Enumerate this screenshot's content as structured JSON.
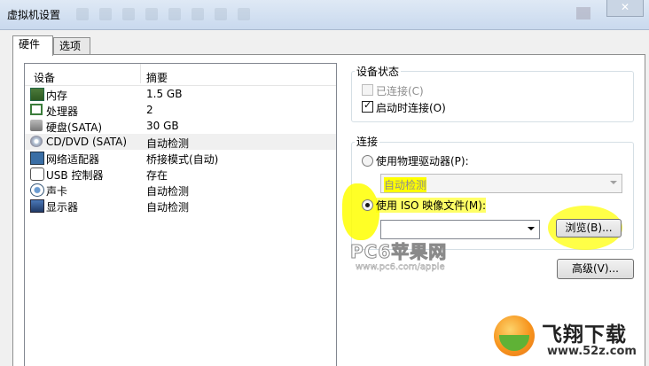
{
  "window": {
    "title": "虚拟机设置"
  },
  "tabs": [
    {
      "label": "硬件"
    },
    {
      "label": "选项"
    }
  ],
  "device_list": {
    "columns": [
      "设备",
      "摘要"
    ],
    "rows": [
      {
        "device": "内存",
        "summary": "1.5 GB",
        "icon": "memory-icon"
      },
      {
        "device": "处理器",
        "summary": "2",
        "icon": "processor-icon"
      },
      {
        "device": "硬盘(SATA)",
        "summary": "30 GB",
        "icon": "harddisk-icon"
      },
      {
        "device": "CD/DVD (SATA)",
        "summary": "自动检测",
        "icon": "cd-dvd-icon",
        "selected": true
      },
      {
        "device": "网络适配器",
        "summary": "桥接模式(自动)",
        "icon": "network-adapter-icon"
      },
      {
        "device": "USB 控制器",
        "summary": "存在",
        "icon": "usb-icon"
      },
      {
        "device": "声卡",
        "summary": "自动检测",
        "icon": "sound-card-icon"
      },
      {
        "device": "显示器",
        "summary": "自动检测",
        "icon": "display-icon"
      }
    ]
  },
  "device_status": {
    "legend": "设备状态",
    "connected_label": "已连接(C)",
    "connected_checked": false,
    "connected_enabled": false,
    "connect_at_power_on_label": "启动时连接(O)",
    "connect_at_power_on_checked": true
  },
  "connection": {
    "legend": "连接",
    "physical_drive_label": "使用物理驱动器(P):",
    "physical_drive_value": "自动检测",
    "iso_label": "使用 ISO 映像文件(M):",
    "iso_value": "",
    "selected_option": "iso",
    "browse_button": "浏览(B)..."
  },
  "advanced_button": "高级(V)...",
  "watermarks": {
    "pc6_main": "PC6苹果网",
    "pc6_url": "www.pc6.com/apple",
    "feixiang_brand": "飞翔下载",
    "feixiang_url": "www.52z.com"
  },
  "colors": {
    "highlight": "#ffff00",
    "titlebar": "#dfe9f5",
    "panel_border": "#8e8f8f",
    "feixiang_orange": "#f7941d",
    "feixiang_green": "#5fb236"
  }
}
